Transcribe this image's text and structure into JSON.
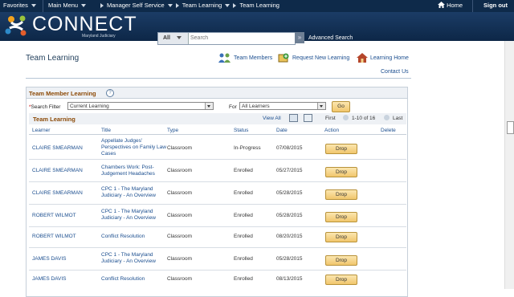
{
  "nav": {
    "favorites": "Favorites",
    "main_menu": "Main Menu",
    "breadcrumbs": [
      "Manager Self Service",
      "Team Learning",
      "Team Learning"
    ],
    "home": "Home",
    "sign_out": "Sign out"
  },
  "header": {
    "logo": "CONNECT",
    "logo_sub": "Maryland Judiciary",
    "search_scope": "All",
    "search_placeholder": "Search",
    "advanced_search": "Advanced Search"
  },
  "page": {
    "title": "Team Learning",
    "links": [
      "Team Members",
      "Request New Learning",
      "Learning Home"
    ],
    "contact": "Contact Us"
  },
  "panel": {
    "title": "Team Member Learning",
    "search_filter_label": "Search Filter",
    "search_filter_value": "Current Learning",
    "for_label": "For",
    "for_value": "All Learners",
    "go": "Go"
  },
  "grid": {
    "title": "Team Learning",
    "view_all": "View All",
    "first": "First",
    "range": "1-10 of 16",
    "last": "Last",
    "columns": [
      "Learner",
      "Title",
      "Type",
      "Status",
      "Date",
      "Action",
      "Delete"
    ],
    "drop_label": "Drop",
    "rows": [
      {
        "learner": "CLAIRE SMEARMAN",
        "title": "Appellate Judges' Perspectives on Family Law Cases",
        "type": "Classroom",
        "status": "In-Progress",
        "date": "07/08/2015"
      },
      {
        "learner": "CLAIRE SMEARMAN",
        "title": "Chambers Work: Post-Judgement Headaches",
        "type": "Classroom",
        "status": "Enrolled",
        "date": "05/27/2015"
      },
      {
        "learner": "CLAIRE SMEARMAN",
        "title": "CPC 1 - The Maryland Judiciary - An Overview",
        "type": "Classroom",
        "status": "Enrolled",
        "date": "05/28/2015"
      },
      {
        "learner": "ROBERT WILMOT",
        "title": "CPC 1 - The Maryland Judiciary - An Overview",
        "type": "Classroom",
        "status": "Enrolled",
        "date": "05/28/2015"
      },
      {
        "learner": "ROBERT WILMOT",
        "title": "Conflict Resolution",
        "type": "Classroom",
        "status": "Enrolled",
        "date": "08/20/2015"
      },
      {
        "learner": "JAMES DAVIS",
        "title": "CPC 1 - The Maryland Judiciary - An Overview",
        "type": "Classroom",
        "status": "Enrolled",
        "date": "05/28/2015"
      },
      {
        "learner": "JAMES DAVIS",
        "title": "Conflict Resolution",
        "type": "Classroom",
        "status": "Enrolled",
        "date": "08/13/2015"
      }
    ]
  }
}
